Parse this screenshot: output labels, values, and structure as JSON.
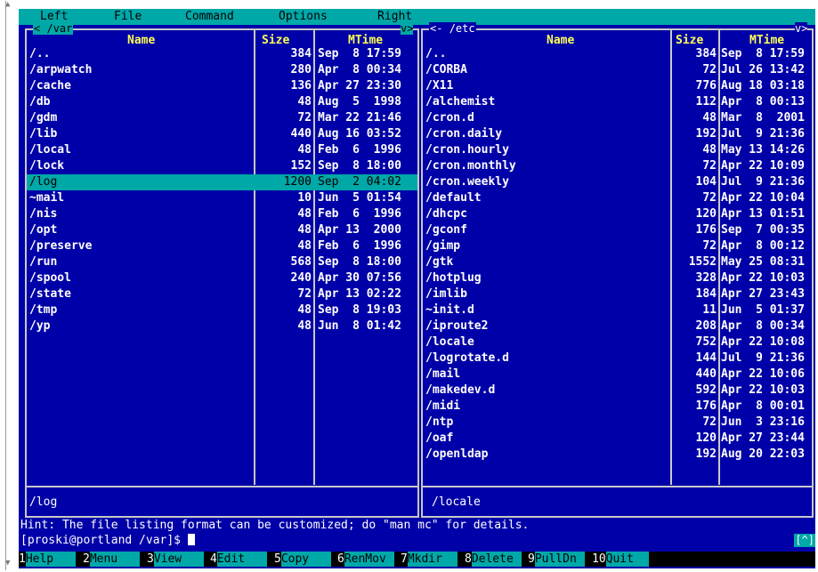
{
  "menubar": {
    "left": "Left",
    "file": "File",
    "command": "Command",
    "options": "Options",
    "right": "Right"
  },
  "columns": {
    "name": "Name",
    "size": "Size",
    "mtime": "MTime"
  },
  "left_panel": {
    "path": "/var",
    "left_arrow": "<",
    "right_arrow": "v>",
    "minibuffer": "/log",
    "rows": [
      {
        "name": "/..",
        "size": "384",
        "mtime": "Sep  8 17:59"
      },
      {
        "name": "/arpwatch",
        "size": "280",
        "mtime": "Apr  8 00:34"
      },
      {
        "name": "/cache",
        "size": "136",
        "mtime": "Apr 27 23:30"
      },
      {
        "name": "/db",
        "size": "48",
        "mtime": "Aug  5  1998"
      },
      {
        "name": "/gdm",
        "size": "72",
        "mtime": "Mar 22 21:46"
      },
      {
        "name": "/lib",
        "size": "440",
        "mtime": "Aug 16 03:52"
      },
      {
        "name": "/local",
        "size": "48",
        "mtime": "Feb  6  1996"
      },
      {
        "name": "/lock",
        "size": "152",
        "mtime": "Sep  8 18:00"
      },
      {
        "name": "/log",
        "size": "1200",
        "mtime": "Sep  2 04:02"
      },
      {
        "name": "~mail",
        "size": "10",
        "mtime": "Jun  5 01:54"
      },
      {
        "name": "/nis",
        "size": "48",
        "mtime": "Feb  6  1996"
      },
      {
        "name": "/opt",
        "size": "48",
        "mtime": "Apr 13  2000"
      },
      {
        "name": "/preserve",
        "size": "48",
        "mtime": "Feb  6  1996"
      },
      {
        "name": "/run",
        "size": "568",
        "mtime": "Sep  8 18:00"
      },
      {
        "name": "/spool",
        "size": "240",
        "mtime": "Apr 30 07:56"
      },
      {
        "name": "/state",
        "size": "72",
        "mtime": "Apr 13 02:22"
      },
      {
        "name": "/tmp",
        "size": "48",
        "mtime": "Sep  8 19:03"
      },
      {
        "name": "/yp",
        "size": "48",
        "mtime": "Jun  8 01:42"
      }
    ]
  },
  "right_panel": {
    "path": "/etc",
    "left_arrow": "<-",
    "right_arrow": "v>",
    "minibuffer": "/locale",
    "rows": [
      {
        "name": "/..",
        "size": "384",
        "mtime": "Sep  8 17:59"
      },
      {
        "name": "/CORBA",
        "size": "72",
        "mtime": "Jul 26 13:42"
      },
      {
        "name": "/X11",
        "size": "776",
        "mtime": "Aug 18 03:18"
      },
      {
        "name": "/alchemist",
        "size": "112",
        "mtime": "Apr  8 00:13"
      },
      {
        "name": "/cron.d",
        "size": "48",
        "mtime": "Mar  8  2001"
      },
      {
        "name": "/cron.daily",
        "size": "192",
        "mtime": "Jul  9 21:36"
      },
      {
        "name": "/cron.hourly",
        "size": "48",
        "mtime": "May 13 14:26"
      },
      {
        "name": "/cron.monthly",
        "size": "72",
        "mtime": "Apr 22 10:09"
      },
      {
        "name": "/cron.weekly",
        "size": "104",
        "mtime": "Jul  9 21:36"
      },
      {
        "name": "/default",
        "size": "72",
        "mtime": "Apr 22 10:04"
      },
      {
        "name": "/dhcpc",
        "size": "120",
        "mtime": "Apr 13 01:51"
      },
      {
        "name": "/gconf",
        "size": "176",
        "mtime": "Sep  7 00:35"
      },
      {
        "name": "/gimp",
        "size": "72",
        "mtime": "Apr  8 00:12"
      },
      {
        "name": "/gtk",
        "size": "1552",
        "mtime": "May 25 08:31"
      },
      {
        "name": "/hotplug",
        "size": "328",
        "mtime": "Apr 22 10:03"
      },
      {
        "name": "/imlib",
        "size": "184",
        "mtime": "Apr 27 23:43"
      },
      {
        "name": "~init.d",
        "size": "11",
        "mtime": "Jun  5 01:37"
      },
      {
        "name": "/iproute2",
        "size": "208",
        "mtime": "Apr  8 00:34"
      },
      {
        "name": "/locale",
        "size": "752",
        "mtime": "Apr 22 10:08"
      },
      {
        "name": "/logrotate.d",
        "size": "144",
        "mtime": "Jul  9 21:36"
      },
      {
        "name": "/mail",
        "size": "440",
        "mtime": "Apr 22 10:06"
      },
      {
        "name": "/makedev.d",
        "size": "592",
        "mtime": "Apr 22 10:03"
      },
      {
        "name": "/midi",
        "size": "176",
        "mtime": "Apr  8 00:01"
      },
      {
        "name": "/ntp",
        "size": "72",
        "mtime": "Jun  3 23:16"
      },
      {
        "name": "/oaf",
        "size": "120",
        "mtime": "Apr 27 23:44"
      },
      {
        "name": "/openldap",
        "size": "192",
        "mtime": "Aug 20 22:03"
      }
    ]
  },
  "hint": "Hint: The file listing format can be customized; do \"man mc\" for details.",
  "prompt": "[proski@portland /var]$ ",
  "badge": "[^]",
  "fkeys": [
    {
      "num": "1",
      "label": "Help"
    },
    {
      "num": "2",
      "label": "Menu"
    },
    {
      "num": "3",
      "label": "View"
    },
    {
      "num": "4",
      "label": "Edit"
    },
    {
      "num": "5",
      "label": "Copy"
    },
    {
      "num": "6",
      "label": "RenMov"
    },
    {
      "num": "7",
      "label": "Mkdir"
    },
    {
      "num": "8",
      "label": "Delete"
    },
    {
      "num": "9",
      "label": "PullDn"
    },
    {
      "num": "10",
      "label": "Quit"
    }
  ],
  "selected_row": "/log",
  "colors": {
    "background": "#0000a8",
    "accent": "#00a8a8",
    "header": "#ffff55",
    "text": "#ffffff"
  }
}
